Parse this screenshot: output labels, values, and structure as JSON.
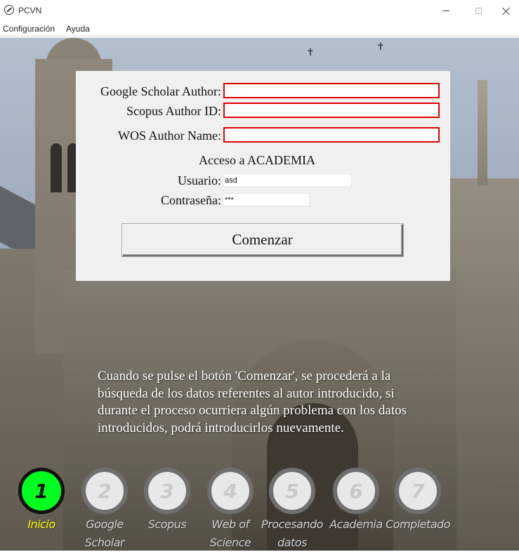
{
  "window": {
    "title": "PCVN"
  },
  "menu": {
    "items": [
      "Configuración",
      "Ayuda"
    ]
  },
  "form": {
    "google_scholar_label": "Google Scholar Author:",
    "google_scholar_value": "",
    "scopus_label": "Scopus Author ID:",
    "scopus_value": "",
    "wos_label": "WOS Author Name:",
    "wos_value": "",
    "academia_title": "Acceso a ACADEMIA",
    "user_label": "Usuario:",
    "user_value": "asd",
    "password_label": "Contraseña:",
    "password_value": "***",
    "start_button": "Comenzar"
  },
  "info": {
    "lines": [
      "Cuando se pulse el botón 'Comenzar', se procederá a la",
      "búsqueda de los datos referentes al autor introducido, si",
      "durante el proceso ocurriera algún problema con los datos",
      "introducidos, podrá introducirlos nuevamente."
    ]
  },
  "steps": [
    {
      "number": "1",
      "label_lines": [
        "Inicio"
      ],
      "active": true
    },
    {
      "number": "2",
      "label_lines": [
        "Google",
        "Scholar"
      ],
      "active": false
    },
    {
      "number": "3",
      "label_lines": [
        "Scopus"
      ],
      "active": false
    },
    {
      "number": "4",
      "label_lines": [
        "Web of",
        "Science"
      ],
      "active": false
    },
    {
      "number": "5",
      "label_lines": [
        "Procesando",
        "datos"
      ],
      "active": false
    },
    {
      "number": "6",
      "label_lines": [
        "Academia"
      ],
      "active": false
    },
    {
      "number": "7",
      "label_lines": [
        "Completado"
      ],
      "active": false
    }
  ],
  "colors": {
    "active_step": "#00ff21",
    "active_label": "#ffff00",
    "required_border": "#e00000"
  }
}
